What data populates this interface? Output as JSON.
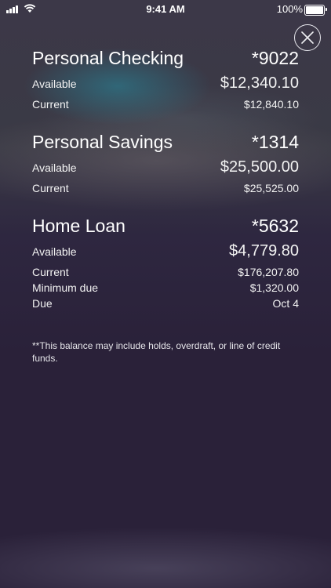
{
  "status": {
    "time": "9:41 AM",
    "battery": "100%"
  },
  "close_icon": "close-icon",
  "accounts": [
    {
      "name": "Personal Checking",
      "number": "*9022",
      "rows": [
        {
          "label": "Available",
          "value": "$12,340.10"
        },
        {
          "label": "Current",
          "value": "$12,840.10"
        }
      ]
    },
    {
      "name": "Personal Savings",
      "number": "*1314",
      "rows": [
        {
          "label": "Available",
          "value": "$25,500.00"
        },
        {
          "label": "Current",
          "value": "$25,525.00"
        }
      ]
    },
    {
      "name": "Home Loan",
      "number": "*5632",
      "rows": [
        {
          "label": "Available",
          "value": "$4,779.80"
        },
        {
          "label": "Current",
          "value": "$176,207.80"
        },
        {
          "label": "Minimum due",
          "value": "$1,320.00"
        },
        {
          "label": "Due",
          "value": "Oct 4"
        }
      ]
    }
  ],
  "footnote": "**This balance may include holds, overdraft, or line of credit funds."
}
